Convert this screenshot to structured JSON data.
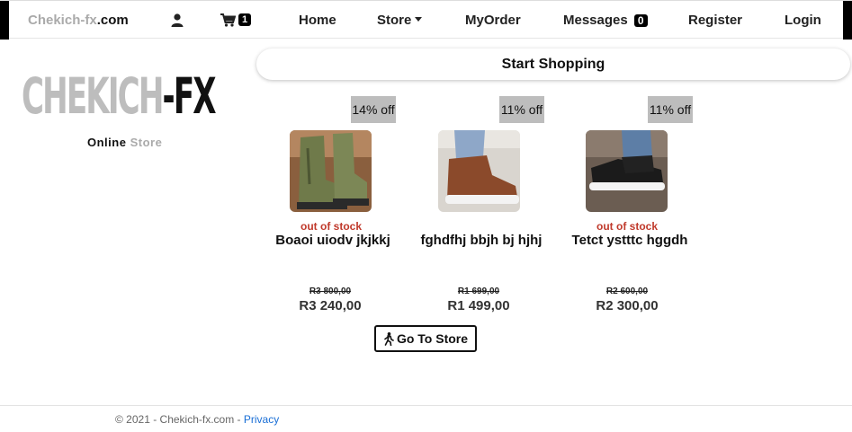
{
  "navbar": {
    "brand_prefix": "Chekich-fx",
    "brand_suffix": ".com",
    "cart_count": "1",
    "links": {
      "home": "Home",
      "store": "Store",
      "myorder": "MyOrder",
      "messages": "Messages",
      "register": "Register",
      "login": "Login"
    },
    "messages_count": "0"
  },
  "sidebar": {
    "logo_part1": "CHEKICH",
    "logo_part2": "-FX",
    "tagline_bold": "Online",
    "tagline_light": "Store"
  },
  "main": {
    "start_shopping": "Start Shopping",
    "go_to_store": "Go To Store",
    "products": [
      {
        "discount": "14% off",
        "stock": "out of stock",
        "name": "Boaoi uiodv jkjkkj",
        "old_price": "R3 800,00",
        "new_price": "R3 240,00",
        "image": "olive-green-boot"
      },
      {
        "discount": "11% off",
        "stock": "",
        "name": "fghdfhj bbjh bj hjhj",
        "old_price": "R1 699,00",
        "new_price": "R1 499,00",
        "image": "brown-sneaker"
      },
      {
        "discount": "11% off",
        "stock": "out of stock",
        "name": "Tetct ystttc hggdh",
        "old_price": "R2 600,00",
        "new_price": "R2 300,00",
        "image": "black-sneaker"
      }
    ]
  },
  "footer": {
    "copyright": "© 2021 - Chekich-fx.com - ",
    "privacy": "Privacy"
  },
  "colors": {
    "accent": "#000000",
    "gray": "#bdbdbd",
    "out_of_stock": "#c0392b",
    "link": "#1a6fd6"
  }
}
